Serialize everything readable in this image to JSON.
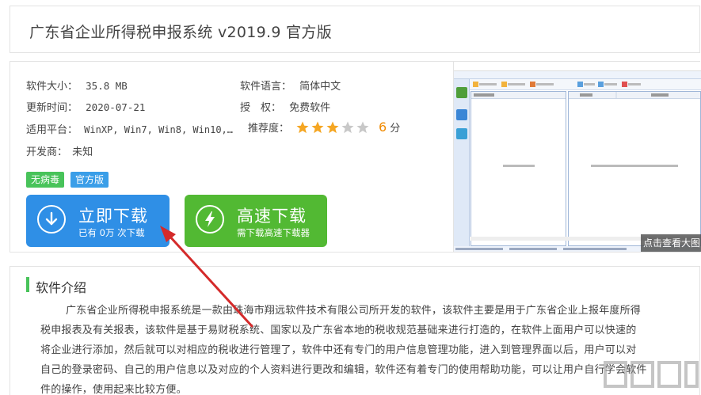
{
  "title": "广东省企业所得税申报系统 v2019.9 官方版",
  "info": {
    "size_label": "软件大小：",
    "size_value": "35.8 MB",
    "lang_label": "软件语言：",
    "lang_value": "简体中文",
    "update_label": "更新时间：",
    "update_value": "2020-07-21",
    "license_label": "授　权：",
    "license_value": "免费软件",
    "platform_label": "适用平台：",
    "platform_value": "WinXP, Win7, Win8, Win10,…",
    "rating_label": "推荐度：",
    "rating_stars": 3,
    "rating_max": 5,
    "rating_score": "6",
    "rating_unit": "分",
    "dev_label": "开发商：",
    "dev_value": "未知"
  },
  "tags": {
    "virus_free": "无病毒",
    "official": "官方版"
  },
  "buttons": {
    "download_main": "立即下载",
    "download_sub": "已有 0万 次下载",
    "fast_main": "高速下载",
    "fast_sub": "需下载高速下载器"
  },
  "colors": {
    "blue_button": "#2f8fe6",
    "green_button": "#52b933",
    "star_on": "#f5a623",
    "star_off": "#c8c8c8",
    "score": "#f08a00",
    "arrow": "#d42a2a",
    "tag_green": "#48c35a",
    "tag_blue": "#3a9ee8"
  },
  "screenshot": {
    "overlay_text": "点击查看大图"
  },
  "intro": {
    "title": "软件介绍",
    "lines": [
      "广东省企业所得税申报系统是一款由珠海市翔远软件技术有限公司所开发的软件，该软件主要是用于广东省企业上报年度所得",
      "税申报表及有关报表，该软件是基于易财税系统、国家以及广东省本地的税收规范基础来进行打造的，在软件上面用户可以快速的",
      "将企业进行添加，然后就可以对相应的税收进行管理了，软件中还有专门的用户信息管理功能，进入到管理界面以后，用户可以对",
      "自己的登录密码、自己的用户信息以及对应的个人资料进行更改和编辑，软件还有着专门的使用帮助功能，可以让用户自行学会软件",
      "件的操作，使用起来比较方便。"
    ]
  }
}
